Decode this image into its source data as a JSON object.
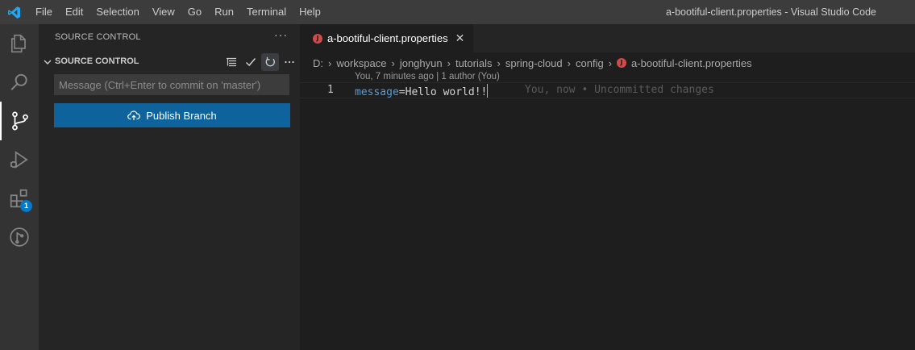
{
  "window": {
    "title": "a-bootiful-client.properties - Visual Studio Code",
    "menu": [
      "File",
      "Edit",
      "Selection",
      "View",
      "Go",
      "Run",
      "Terminal",
      "Help"
    ]
  },
  "activity_bar": {
    "items": [
      {
        "name": "explorer",
        "icon": "files-icon"
      },
      {
        "name": "search",
        "icon": "search-icon"
      },
      {
        "name": "source-control",
        "icon": "source-control-icon",
        "active": true
      },
      {
        "name": "run-debug",
        "icon": "run-debug-icon"
      },
      {
        "name": "extensions",
        "icon": "extensions-icon",
        "badge": "1"
      },
      {
        "name": "git-graph",
        "icon": "git-graph-icon"
      }
    ]
  },
  "sidebar": {
    "title": "SOURCE CONTROL",
    "more": "···",
    "section_title": "SOURCE CONTROL",
    "commit_placeholder": "Message (Ctrl+Enter to commit on 'master')",
    "publish_label": "Publish Branch"
  },
  "editor": {
    "tab_label": "a-bootiful-client.properties",
    "tab_icon": "J",
    "breadcrumb": [
      "D:",
      "workspace",
      "jonghyun",
      "tutorials",
      "spring-cloud",
      "config",
      "a-bootiful-client.properties"
    ],
    "codelens": "You, 7 minutes ago | 1 author (You)",
    "line_number": "1",
    "code": {
      "key": "message",
      "eq": "=",
      "value": "Hello world!!"
    },
    "blame": "You, now • Uncommitted changes"
  },
  "colors": {
    "accent": "#007acc",
    "button": "#0e639c",
    "properties_icon": "#d24a4a",
    "key_token": "#569cd6"
  }
}
